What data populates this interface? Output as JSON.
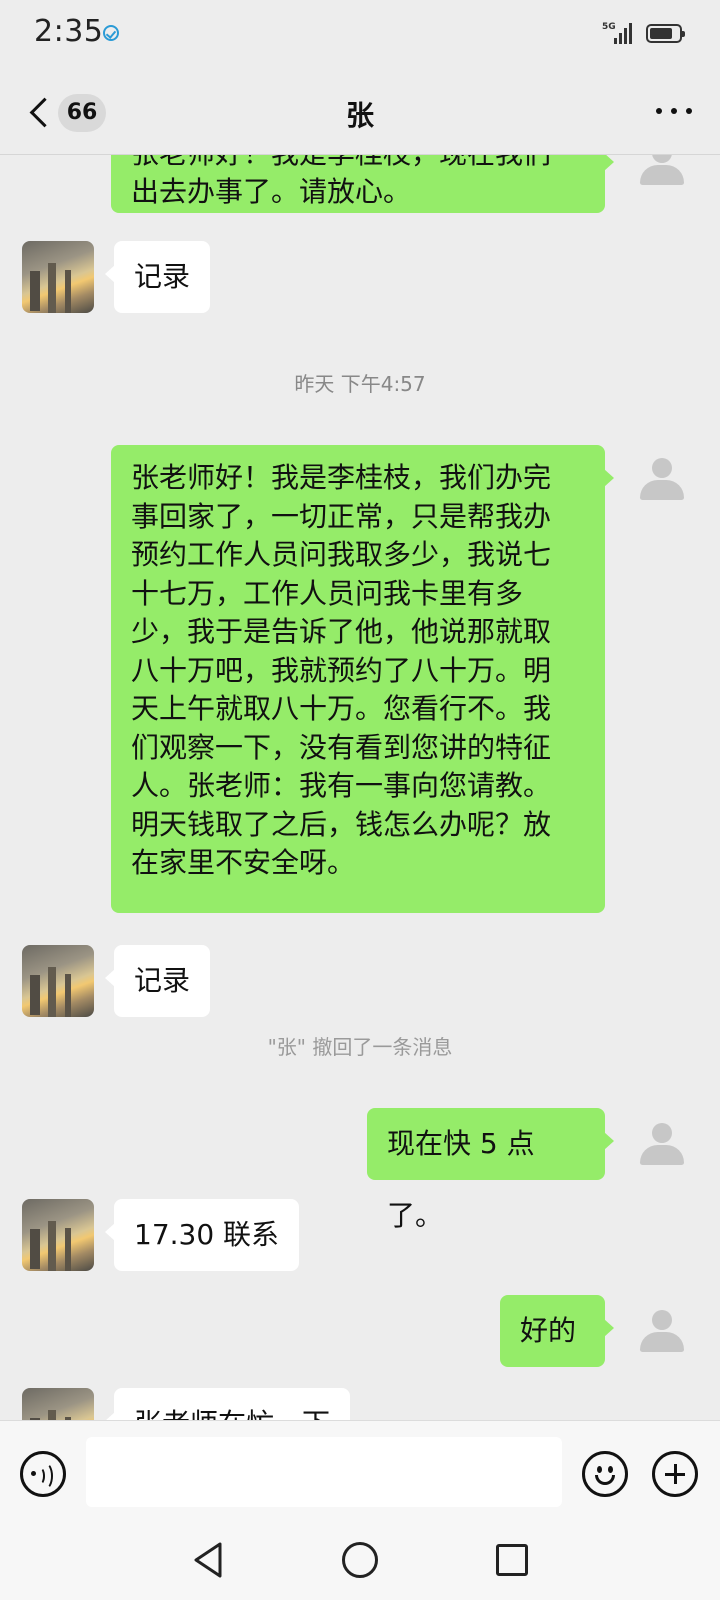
{
  "status_bar": {
    "time": "2:35",
    "network": "5G"
  },
  "header": {
    "unread_count": "66",
    "title": "张"
  },
  "messages": {
    "m0_lines": [
      "张老师好！我是李桂枝，现在我们",
      "出去办事了。请放心。"
    ],
    "m1_text": "记录",
    "timestamp": "昨天 下午4:57",
    "m2_lines": [
      "张老师好！我是李桂枝，我们办完",
      "事回家了，一切正常，只是帮我办",
      "预约工作人员问我取多少，我说七",
      "十七万，工作人员问我卡里有多",
      "少，我于是告诉了他，他说那就取",
      "八十万吧，我就预约了八十万。明",
      "天上午就取八十万。您看行不。我",
      "们观察一下，没有看到您讲的特征",
      "人。张老师：我有一事向您请教。",
      "明天钱取了之后，钱怎么办呢？放",
      "在家里不安全呀。"
    ],
    "m3_text": "记录",
    "recall_notice": "\"张\" 撤回了一条消息",
    "m4_text": "现在快 5 点了。",
    "m5_text": "17.30 联系",
    "m6_text": "好的",
    "m7_text": "张老师在忙一下"
  },
  "input": {
    "placeholder": ""
  },
  "colors": {
    "background": "#ededed",
    "sent_bubble": "#95ec69",
    "received_bubble": "#ffffff"
  },
  "icons": [
    "back-chevron",
    "more-dots",
    "voice",
    "emoji",
    "plus",
    "nav-back",
    "nav-home",
    "nav-recent"
  ]
}
